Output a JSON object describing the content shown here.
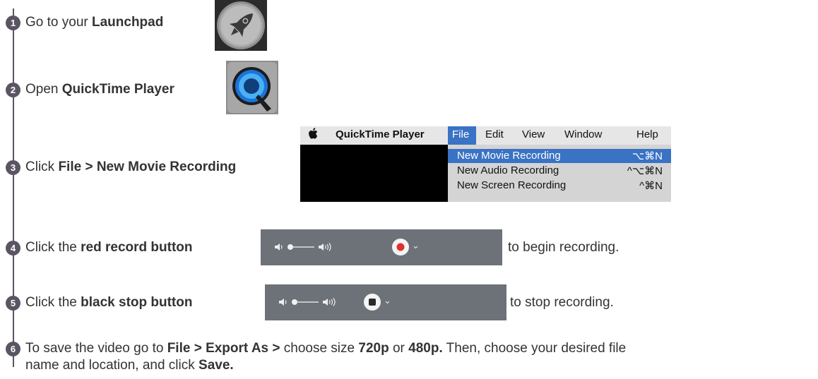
{
  "steps": [
    {
      "num": "1",
      "pre": "Go to your ",
      "bold": "Launchpad",
      "icon": "launchpad-rocket-icon"
    },
    {
      "num": "2",
      "pre": "Open ",
      "bold": "QuickTime Player",
      "icon": "quicktime-player-icon"
    },
    {
      "num": "3",
      "pre": "Click ",
      "bold": "File > New Movie Recording"
    },
    {
      "num": "4",
      "pre": "Click the ",
      "bold": "red record button",
      "post": "to begin recording."
    },
    {
      "num": "5",
      "pre": "Click the ",
      "bold": "black stop button",
      "post": "to stop recording."
    },
    {
      "num": "6",
      "p1": "To save the video go to ",
      "b1": "File > Export As >",
      "p2": " choose size ",
      "b2": "720p",
      "p3": " or ",
      "b3": "480p.",
      "p4": " Then, choose your desired file",
      "p5": "name and location, and click ",
      "b4": "Save."
    }
  ],
  "menu": {
    "apple": "",
    "app": "QuickTime Player",
    "file": "File",
    "edit": "Edit",
    "view": "View",
    "window": "Window",
    "help": "Help",
    "items": [
      {
        "label": "New Movie Recording",
        "shortcut": "⌥⌘N",
        "selected": true
      },
      {
        "label": "New Audio Recording",
        "shortcut": "^⌥⌘N",
        "selected": false
      },
      {
        "label": "New Screen Recording",
        "shortcut": "^⌘N",
        "selected": false
      }
    ]
  },
  "colors": {
    "accent": "#5b5462",
    "menu_highlight": "#3a72c4",
    "record_red": "#e0302f",
    "bar_gray": "#6d7178"
  }
}
